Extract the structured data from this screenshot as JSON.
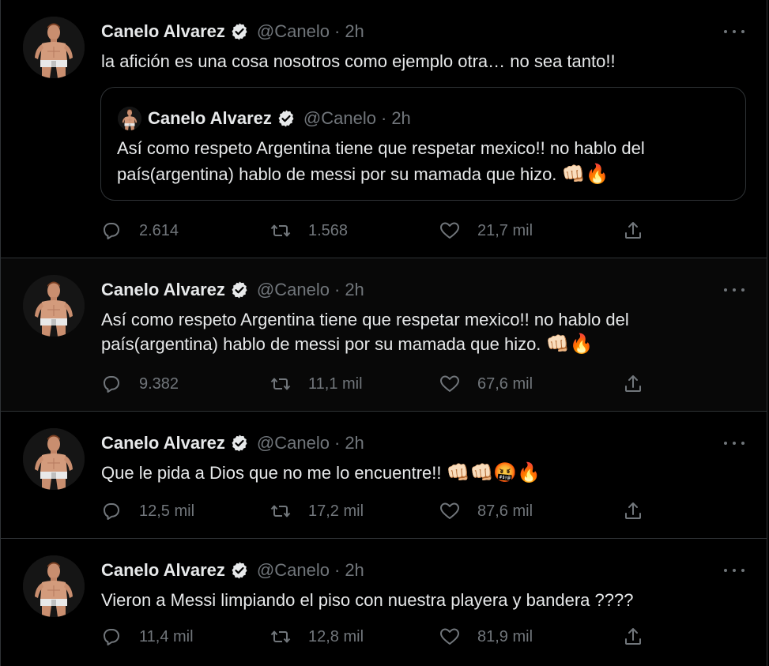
{
  "author": {
    "name": "Canelo Alvarez",
    "handle": "@Canelo",
    "separator": "·"
  },
  "icons": {
    "verified": "verified-badge-icon",
    "more": "more-options-icon",
    "reply": "reply-icon",
    "retweet": "retweet-icon",
    "like": "heart-icon",
    "share": "share-icon"
  },
  "colors": {
    "background": "#000000",
    "text": "#e7e9ea",
    "muted": "#71767b",
    "border": "#2f3336"
  },
  "tweets": [
    {
      "time": "2h",
      "text": "la afición es una cosa nosotros como ejemplo otra… no sea tanto!!",
      "quote": {
        "name": "Canelo Alvarez",
        "handle": "@Canelo",
        "time": "2h",
        "line1": "Así como respeto Argentina tiene que respetar mexico!! no hablo del",
        "line2": "país(argentina) hablo de messi por su mamada que hizo.",
        "emojis": "👊🏻🔥"
      },
      "replies": "2.614",
      "retweets": "1.568",
      "likes": "21,7 mil"
    },
    {
      "time": "2h",
      "line1": "Así como respeto Argentina tiene que respetar mexico!! no hablo del",
      "line2": "país(argentina) hablo de messi por su mamada que hizo.",
      "emojis": "👊🏻🔥",
      "replies": "9.382",
      "retweets": "11,1 mil",
      "likes": "67,6 mil"
    },
    {
      "time": "2h",
      "text": "Que le pida a Dios que no me lo encuentre!!",
      "emojis": "👊🏻👊🏻🤬🔥",
      "replies": "12,5 mil",
      "retweets": "17,2 mil",
      "likes": "87,6 mil"
    },
    {
      "time": "2h",
      "text": "Vieron a Messi limpiando el piso con nuestra playera y bandera ????",
      "replies": "11,4 mil",
      "retweets": "12,8 mil",
      "likes": "81,9 mil"
    }
  ]
}
